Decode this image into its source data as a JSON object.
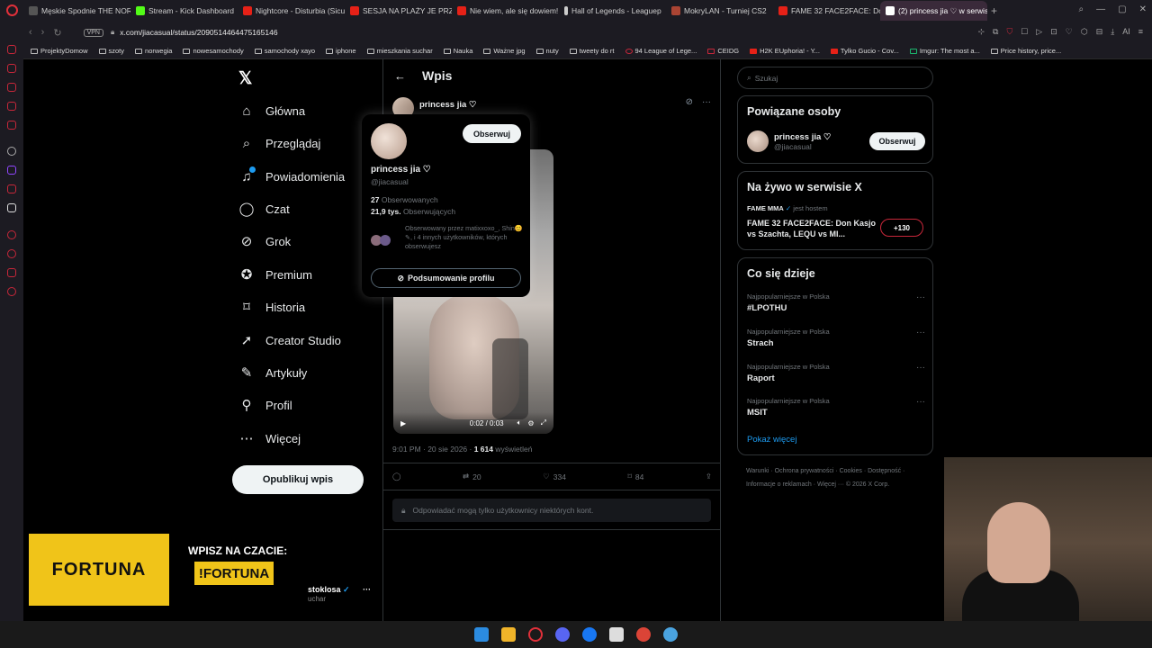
{
  "browser": {
    "tabs": [
      {
        "label": "Męskie Spodnie THE NORT",
        "icon": "m-icon",
        "color": "#555555"
      },
      {
        "label": "Stream - Kick Dashboard",
        "icon": "kick-icon",
        "color": "#53fc18"
      },
      {
        "label": "Nightcore - Disturbia (Sicu",
        "icon": "youtube-icon",
        "color": "#e62117"
      },
      {
        "label": "SESJA NA PLAŻY JE PRZE",
        "icon": "youtube-icon",
        "color": "#e62117"
      },
      {
        "label": "Nie wiem, ale się dowiem!",
        "icon": "youtube-icon",
        "color": "#e62117"
      },
      {
        "label": "Hall of Legends - Leaguep",
        "icon": "pin-icon",
        "color": "#cccccc"
      },
      {
        "label": "MokryLAN - Turniej CS2",
        "icon": "mokrylan-icon",
        "color": "#aa4433"
      },
      {
        "label": "FAME 32 FACE2FACE: Don",
        "icon": "youtube-icon",
        "color": "#e62117"
      },
      {
        "label": "(2) princess jia ♡ w serwis",
        "icon": "x-icon",
        "color": "#ffffff",
        "active": true
      }
    ],
    "new_tab": "+",
    "vpn": "VPN",
    "url": "x.com/jiacasual/status/2090514464475165146",
    "ai_label": "AI",
    "bookmarks": [
      "ProjektyDomow",
      "szoty",
      "norwegia",
      "nowesamochody",
      "samochody xayo",
      "iphone",
      "mieszkania suchar",
      "Nauka",
      "Ważne jpg",
      "nuty",
      "tweety do rt",
      "94 League of Lege...",
      "CEIDG",
      "H2K EUphoria! - Y...",
      "Tylko Gucio - Cov...",
      "Imgur: The most a...",
      "Price history, price..."
    ]
  },
  "nav": {
    "logo": "𝕏",
    "items": [
      "Główna",
      "Przeglądaj",
      "Powiadomienia",
      "Czat",
      "Grok",
      "Premium",
      "Historia",
      "Creator Studio",
      "Artykuły",
      "Profil",
      "Więcej"
    ],
    "publish": "Opublikuj wpis"
  },
  "post": {
    "header": "Wpis",
    "author": "princess jia ♡",
    "video_time": "0:02 / 0:03",
    "meta_time": "9:01 PM · 20 sie 2026 · ",
    "views": "1 614",
    "views_label": " wyświetleń",
    "retweets": "20",
    "likes": "334",
    "bookmarks": "84",
    "reply_restrict": "Odpowiadać mogą tylko użytkownicy niektórych kont."
  },
  "popover": {
    "follow": "Obserwuj",
    "name": "princess jia ♡",
    "handle": "@jiacasual",
    "following_count": "27",
    "following_label": "Obserwowanych",
    "followers_count": "21,9 tys.",
    "followers_label": "Obserwujących",
    "mutual": "Obserwowany przez matixxoxo_, Shin😊✎, i 4 innych użytkowników, których obserwujesz",
    "summary": "Podsumowanie profilu"
  },
  "right": {
    "search_placeholder": "Szukaj",
    "related_title": "Powiązane osoby",
    "related_name": "princess jia ♡",
    "related_handle": "@jiacasual",
    "related_follow": "Obserwuj",
    "live_title": "Na żywo w serwisie X",
    "live_host_name": "FAME MMA",
    "live_host_suffix": " jest hostem",
    "live_event": "FAME 32 FACE2FACE: Don Kasjo vs Szachta, LEQU vs MI...",
    "live_count": "+130",
    "trends_title": "Co się dzieje",
    "trends": [
      {
        "category": "Najpopularniejsze w Polska",
        "name": "#LPOTHU"
      },
      {
        "category": "Najpopularniejsze w Polska",
        "name": "Strach"
      },
      {
        "category": "Najpopularniejsze w Polska",
        "name": "Raport"
      },
      {
        "category": "Najpopularniejsze w Polska",
        "name": "MSIT"
      }
    ],
    "show_more": "Pokaż więcej",
    "footer": "Warunki · Ochrona prywatności · Cookies · Dostępność · Informacje o reklamach · Więcej ··· © 2026 X Corp."
  },
  "overlay": {
    "fortuna_logo": "FORTUNA",
    "cta": "WPISZ NA CZACIE:",
    "command": "!FORTUNA",
    "user": "stoklosa",
    "user_sub": "uchar"
  }
}
